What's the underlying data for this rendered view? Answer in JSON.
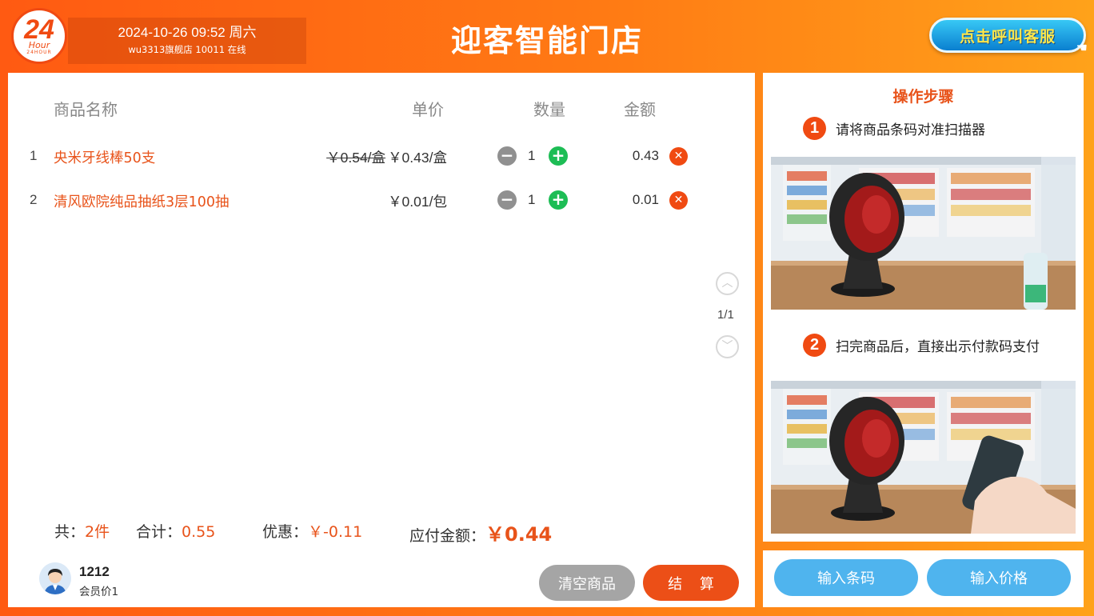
{
  "header": {
    "logo": {
      "number": "24",
      "text": "Hour",
      "sub": "24HOUR"
    },
    "datetime": "2024-10-26 09:52  周六",
    "store_status": "wu3313旗舰店  10011  在线",
    "title": "迎客智能门店",
    "call_button": "点击呼叫客服"
  },
  "cart": {
    "columns": {
      "name": "商品名称",
      "price": "单价",
      "qty": "数量",
      "amount": "金额"
    },
    "items": [
      {
        "index": "1",
        "name": "央米牙线棒50支",
        "old_price": "￥0.54/盒",
        "price": "￥0.43/盒",
        "qty": "1",
        "amount": "0.43"
      },
      {
        "index": "2",
        "name": "清风欧院纯品抽纸3层100抽",
        "old_price": "",
        "price": "￥0.01/包",
        "qty": "1",
        "amount": "0.01"
      }
    ],
    "pager": "1/1"
  },
  "summary": {
    "count_label": "共：",
    "count_value": "2件",
    "total_label": "合计：",
    "total_value": "0.55",
    "discount_label": "优惠：",
    "discount_value": "￥-0.11",
    "pay_label": "应付金额：",
    "pay_value": "￥0.44"
  },
  "member": {
    "id": "1212",
    "level": "会员价1"
  },
  "actions": {
    "clear": "清空商品",
    "checkout": "结 算"
  },
  "steps": {
    "title": "操作步骤",
    "step1_num": "1",
    "step1_text": "请将商品条码对准扫描器",
    "step2_num": "2",
    "step2_text": "扫完商品后，直接出示付款码支付"
  },
  "inputs": {
    "barcode": "输入条码",
    "price": "输入价格"
  },
  "colors": {
    "accent": "#e8531a",
    "plus": "#1dbd55",
    "minus": "#909090",
    "input_btn": "#4fb4ee"
  }
}
